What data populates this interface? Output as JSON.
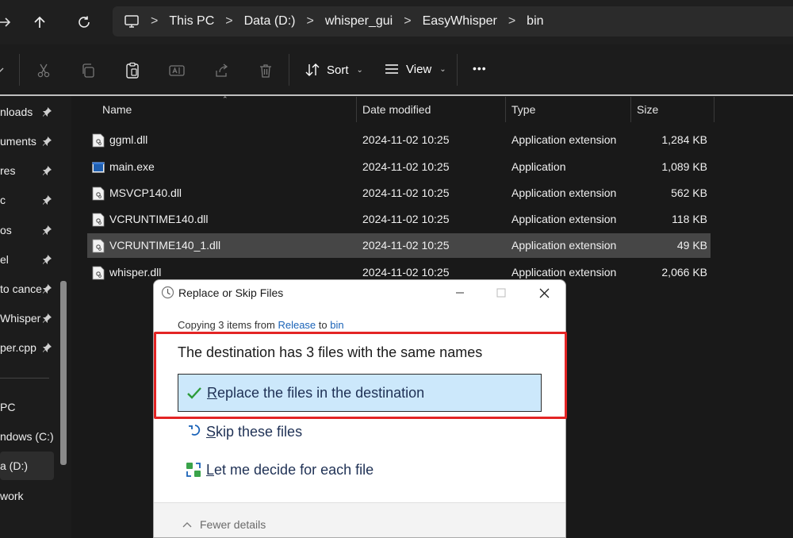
{
  "addressbar": {
    "crumbs": [
      "This PC",
      "Data (D:)",
      "whisper_gui",
      "EasyWhisper",
      "bin"
    ],
    "separator": ">"
  },
  "commandbar": {
    "sort_label": "Sort",
    "view_label": "View",
    "more_label": "•••"
  },
  "sidebar": {
    "items": [
      {
        "label": "nloads",
        "pinned": true
      },
      {
        "label": "uments",
        "pinned": true
      },
      {
        "label": "res",
        "pinned": true
      },
      {
        "label": "c",
        "pinned": true
      },
      {
        "label": "os",
        "pinned": true
      },
      {
        "label": "el",
        "pinned": true
      },
      {
        "label": "to cance",
        "pinned": true
      },
      {
        "label": "Whisper",
        "pinned": true
      },
      {
        "label": "per.cpp",
        "pinned": true
      }
    ],
    "drives": [
      {
        "label": "PC"
      },
      {
        "label": "ndows (C:)"
      },
      {
        "label": "a (D:)",
        "selected": true
      },
      {
        "label": "work"
      }
    ]
  },
  "filelist": {
    "columns": {
      "name": "Name",
      "date": "Date modified",
      "type": "Type",
      "size": "Size"
    },
    "rows": [
      {
        "name": "ggml.dll",
        "date": "2024-11-02 10:25",
        "type": "Application extension",
        "size": "1,284 KB",
        "icon": "dll-file-icon"
      },
      {
        "name": "main.exe",
        "date": "2024-11-02 10:25",
        "type": "Application",
        "size": "1,089 KB",
        "icon": "exe-file-icon"
      },
      {
        "name": "MSVCP140.dll",
        "date": "2024-11-02 10:25",
        "type": "Application extension",
        "size": "562 KB",
        "icon": "dll-file-icon"
      },
      {
        "name": "VCRUNTIME140.dll",
        "date": "2024-11-02 10:25",
        "type": "Application extension",
        "size": "118 KB",
        "icon": "dll-file-icon"
      },
      {
        "name": "VCRUNTIME140_1.dll",
        "date": "2024-11-02 10:25",
        "type": "Application extension",
        "size": "49 KB",
        "icon": "dll-file-icon",
        "selected": true
      },
      {
        "name": "whisper.dll",
        "date": "2024-11-02 10:25",
        "type": "Application extension",
        "size": "2,066 KB",
        "icon": "dll-file-icon"
      }
    ]
  },
  "dialog": {
    "title": "Replace or Skip Files",
    "copying_prefix": "Copying 3 items from",
    "source": "Release",
    "to_word": "to",
    "destination": "bin",
    "message": "The destination has 3 files with the same names",
    "options": {
      "replace": {
        "accel": "R",
        "rest": "eplace the files in the destination"
      },
      "skip": {
        "accel": "S",
        "rest": "kip these files"
      },
      "decide": {
        "accel": "L",
        "rest": "et me decide for each file"
      }
    },
    "fewer_details": "Fewer details"
  },
  "colors": {
    "highlight": "#e32424",
    "selected_option": "#cce8fb",
    "link": "#1a63b8"
  }
}
